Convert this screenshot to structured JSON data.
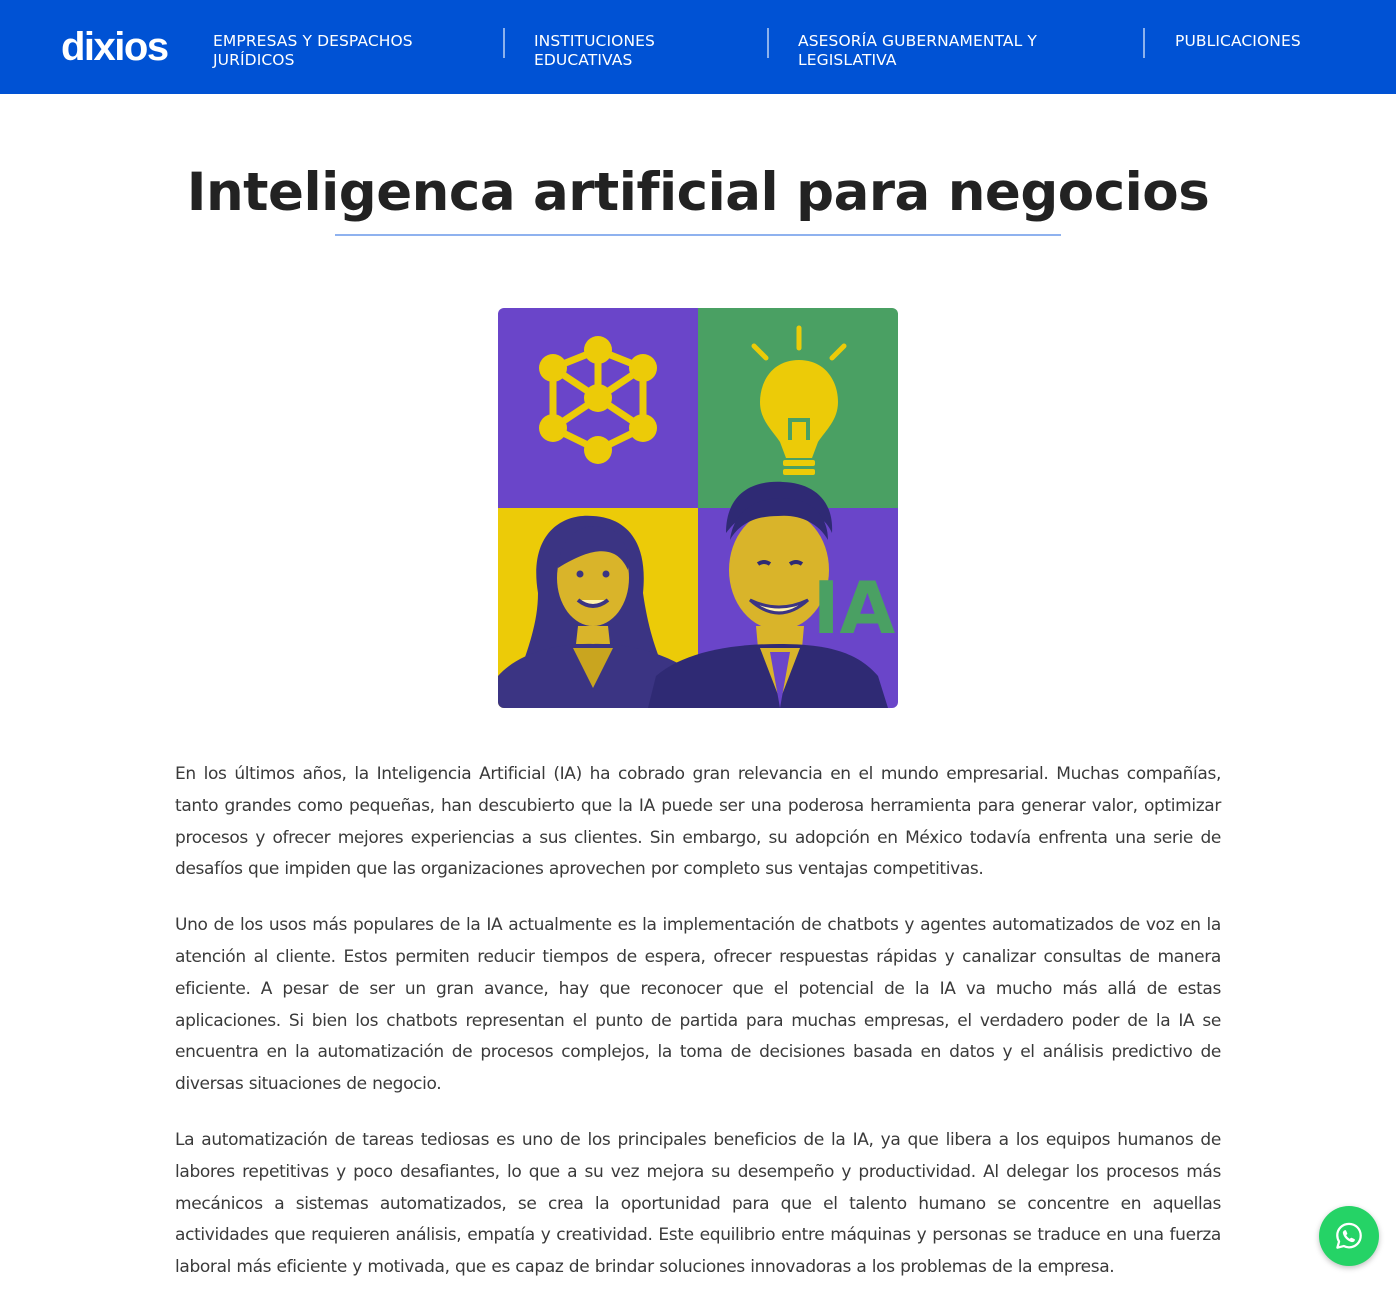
{
  "brand": {
    "logo_text": "dixios",
    "primary_color": "#0052d4"
  },
  "nav": {
    "items": [
      {
        "label": "EMPRESAS Y DESPACHOS JURÍDICOS"
      },
      {
        "label": "INSTITUCIONES EDUCATIVAS"
      },
      {
        "label": "ASESORÍA GUBERNAMENTAL Y LEGISLATIVA"
      },
      {
        "label": "PUBLICACIONES"
      }
    ]
  },
  "article": {
    "title": "Inteligenca artificial para negocios",
    "hero_image": {
      "badge_text": "IA",
      "panels": [
        "network-icon",
        "lightbulb-icon",
        "woman-portrait",
        "man-portrait"
      ],
      "colors": {
        "purple": "#6a45c9",
        "green": "#4aa063",
        "yellow": "#eccb08"
      }
    },
    "paragraphs": [
      "En los últimos años, la Inteligencia Artificial (IA) ha cobrado gran relevancia en el mundo empresarial. Muchas compañías, tanto grandes como pequeñas, han descubierto que la IA puede ser una poderosa herramienta para generar valor, optimizar procesos y ofrecer mejores experiencias a sus clientes. Sin embargo, su adopción en México todavía enfrenta una serie de desafíos que impiden que las organizaciones aprovechen por completo sus ventajas competitivas.",
      "Uno de los usos más populares de la IA actualmente es la implementación de chatbots y agentes automatizados de voz en la atención al cliente. Estos permiten reducir tiempos de espera, ofrecer respuestas rápidas y canalizar consultas de manera eficiente. A pesar de ser un gran avance, hay que reconocer que el potencial de la IA va mucho más allá de estas aplicaciones. Si bien los chatbots representan el punto de partida para muchas empresas, el verdadero poder de la IA se encuentra en la automatización de procesos complejos, la toma de decisiones basada en datos y el análisis predictivo de diversas situaciones de negocio.",
      "La automatización de tareas tediosas es uno de los principales beneficios de la IA, ya que libera a los equipos humanos de labores repetitivas y poco desafiantes, lo que a su vez mejora su desempeño y productividad. Al delegar los procesos más mecánicos a sistemas automatizados, se crea la oportunidad para que el talento humano se concentre en aquellas actividades que requieren análisis, empatía y creatividad. Este equilibrio entre máquinas y personas se traduce en una fuerza laboral más eficiente y motivada, que es capaz de brindar soluciones innovadoras a los problemas de la empresa."
    ]
  },
  "fab": {
    "icon": "whatsapp-icon",
    "color": "#25d366"
  }
}
